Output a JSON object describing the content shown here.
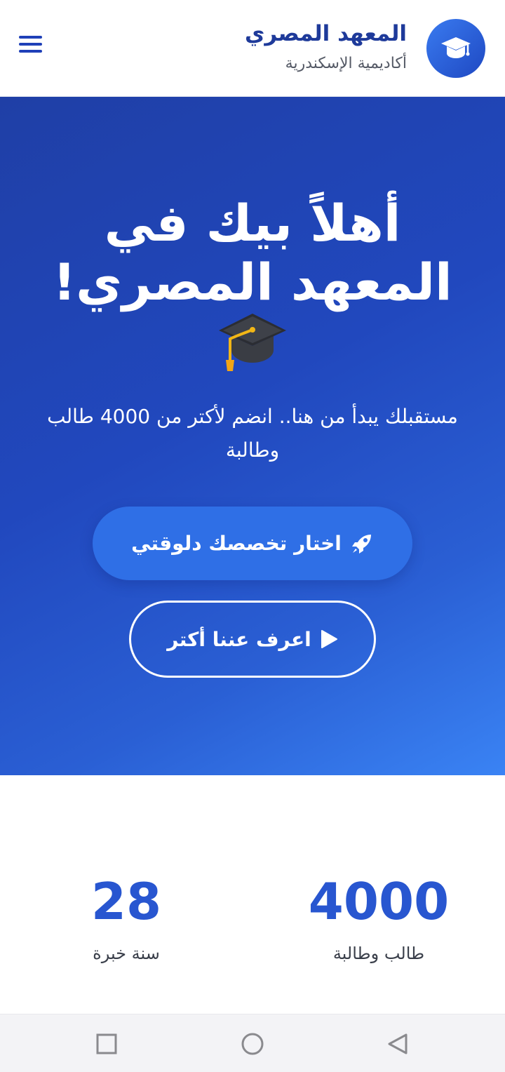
{
  "header": {
    "title": "المعهد المصري",
    "subtitle": "أكاديمية الإسكندرية",
    "logo_icon": "graduation-cap-icon",
    "menu_icon": "hamburger-menu-icon"
  },
  "hero": {
    "title_line1": "أهلاً بيك في",
    "title_line2": "المعهد المصري!",
    "emoji": "🎓",
    "subtitle": "مستقبلك يبدأ من هنا.. انضم لأكتر من 4000 طالب وطالبة",
    "primary_button": {
      "label": "اختار تخصصك دلوقتي",
      "icon": "rocket-icon"
    },
    "secondary_button": {
      "label": "اعرف عننا أكتر",
      "icon": "play-icon"
    }
  },
  "stats": [
    {
      "value": "4000",
      "label": "طالب وطالبة"
    },
    {
      "value": "28",
      "label": "سنة خبرة"
    }
  ],
  "colors": {
    "brand_dark": "#1e3a9a",
    "hero_start": "#1f3fa6",
    "hero_end": "#3a83f4",
    "stat_number": "#2856d0"
  },
  "system_nav": {
    "recent_icon": "square-recent-apps-icon",
    "home_icon": "circle-home-icon",
    "back_icon": "triangle-back-icon"
  }
}
